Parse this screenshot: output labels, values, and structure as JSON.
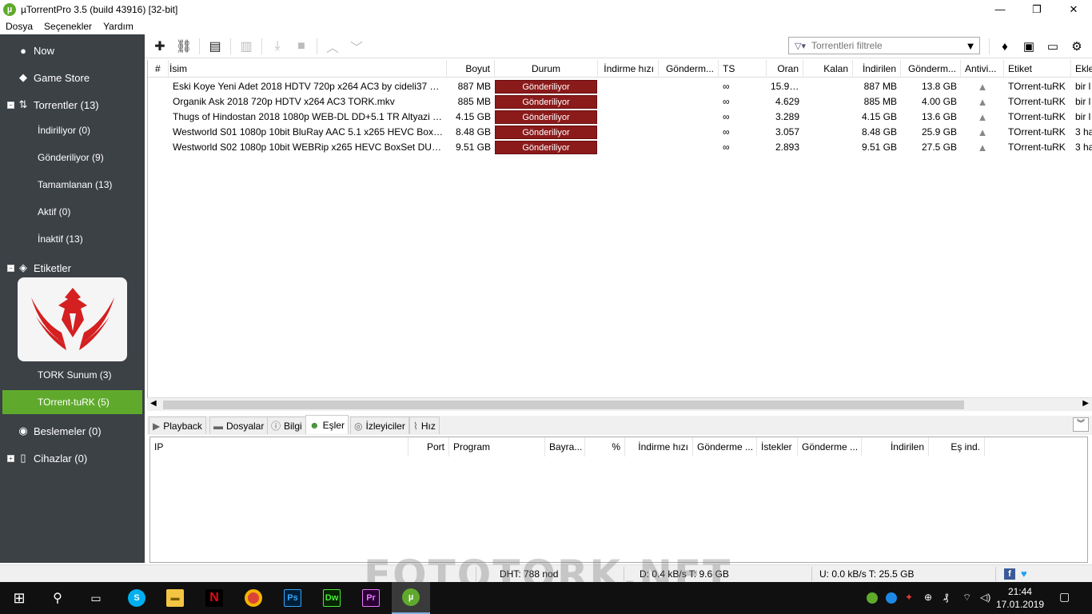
{
  "window": {
    "title": "µTorrentPro 3.5  (build 43916) [32-bit]",
    "app_icon": "utorrent-icon",
    "minimize": "—",
    "maximize": "❐",
    "close": "✕"
  },
  "menu": [
    "Dosya",
    "Seçenekler",
    "Yardım"
  ],
  "sidebar": {
    "now": "Now",
    "game_store": "Game Store",
    "torrents": "Torrentler (13)",
    "torrent_filters": [
      "İndiriliyor (0)",
      "Gönderiliyor (9)",
      "Tamamlanan (13)",
      "Aktif (0)",
      "İnaktif (13)"
    ],
    "labels": "Etiketler",
    "label_items": [
      "TORK Sunum (3)",
      "TOrrent-tuRK (5)"
    ],
    "feeds": "Beslemeler (0)",
    "devices": "Cihazlar (0)",
    "active_color": "#5faa2c"
  },
  "toolbar": {
    "filter_placeholder": "Torrentleri filtrele"
  },
  "torrent_table": {
    "columns": [
      "#",
      "İsim",
      "Boyut",
      "Durum",
      "İndirme hızı",
      "Gönderm...",
      "TS",
      "Oran",
      "Kalan",
      "İndirilen",
      "Gönderm...",
      "Antivi...",
      "Etiket",
      "Ekle"
    ],
    "rows": [
      {
        "name": "Eski Koye Yeni Adet 2018 HDTV 720p x264 AC3 by cideli37 TORK...",
        "size": "887 MB",
        "status": "Gönderiliyor",
        "ts": "∞",
        "ratio": "15.952",
        "downloaded": "887 MB",
        "uploaded": "13.8 GB",
        "label": "TOrrent-tuRK",
        "added": "bir l"
      },
      {
        "name": "Organik Ask 2018 720p HDTV x264 AC3 TORK.mkv",
        "size": "885 MB",
        "status": "Gönderiliyor",
        "ts": "∞",
        "ratio": "4.629",
        "downloaded": "885 MB",
        "uploaded": "4.00 GB",
        "label": "TOrrent-tuRK",
        "added": "bir l"
      },
      {
        "name": "Thugs of Hindostan 2018 1080p WEB-DL DD+5.1 TR Altyazi TORK",
        "size": "4.15 GB",
        "status": "Gönderiliyor",
        "ts": "∞",
        "ratio": "3.289",
        "downloaded": "4.15 GB",
        "uploaded": "13.6 GB",
        "label": "TOrrent-tuRK",
        "added": "bir l"
      },
      {
        "name": "Westworld S01 1080p 10bit BluRay AAC 5.1 x265 HEVC BoxSet T...",
        "size": "8.48 GB",
        "status": "Gönderiliyor",
        "ts": "∞",
        "ratio": "3.057",
        "downloaded": "8.48 GB",
        "uploaded": "25.9 GB",
        "label": "TOrrent-tuRK",
        "added": "3 ha"
      },
      {
        "name": "Westworld S02 1080p 10bit WEBRip x265 HEVC BoxSet DUAL TR...",
        "size": "9.51 GB",
        "status": "Gönderiliyor",
        "ts": "∞",
        "ratio": "2.893",
        "downloaded": "9.51 GB",
        "uploaded": "27.5 GB",
        "label": "TOrrent-tuRK",
        "added": "3 ha"
      }
    ],
    "status_color": "#8b1a1a"
  },
  "detail_tabs": [
    "Playback",
    "Dosyalar",
    "Bilgi",
    "Eşler",
    "İzleyiciler",
    "Hız"
  ],
  "peers_table": {
    "columns": [
      "IP",
      "Port",
      "Program",
      "Bayra...",
      "%",
      "İndirme hızı",
      "Gönderme ...",
      "İstekler",
      "Gönderme ...",
      "İndirilen",
      "Eş ind."
    ]
  },
  "statusbar": {
    "dht": "DHT: 788 nod",
    "download": "D: 0.4 kB/s T: 9.6 GB",
    "upload": "U: 0.0 kB/s T: 25.5 GB"
  },
  "watermark": "FOTOTORK.NET",
  "taskbar": {
    "time": "21:44",
    "date": "17.01.2019"
  }
}
